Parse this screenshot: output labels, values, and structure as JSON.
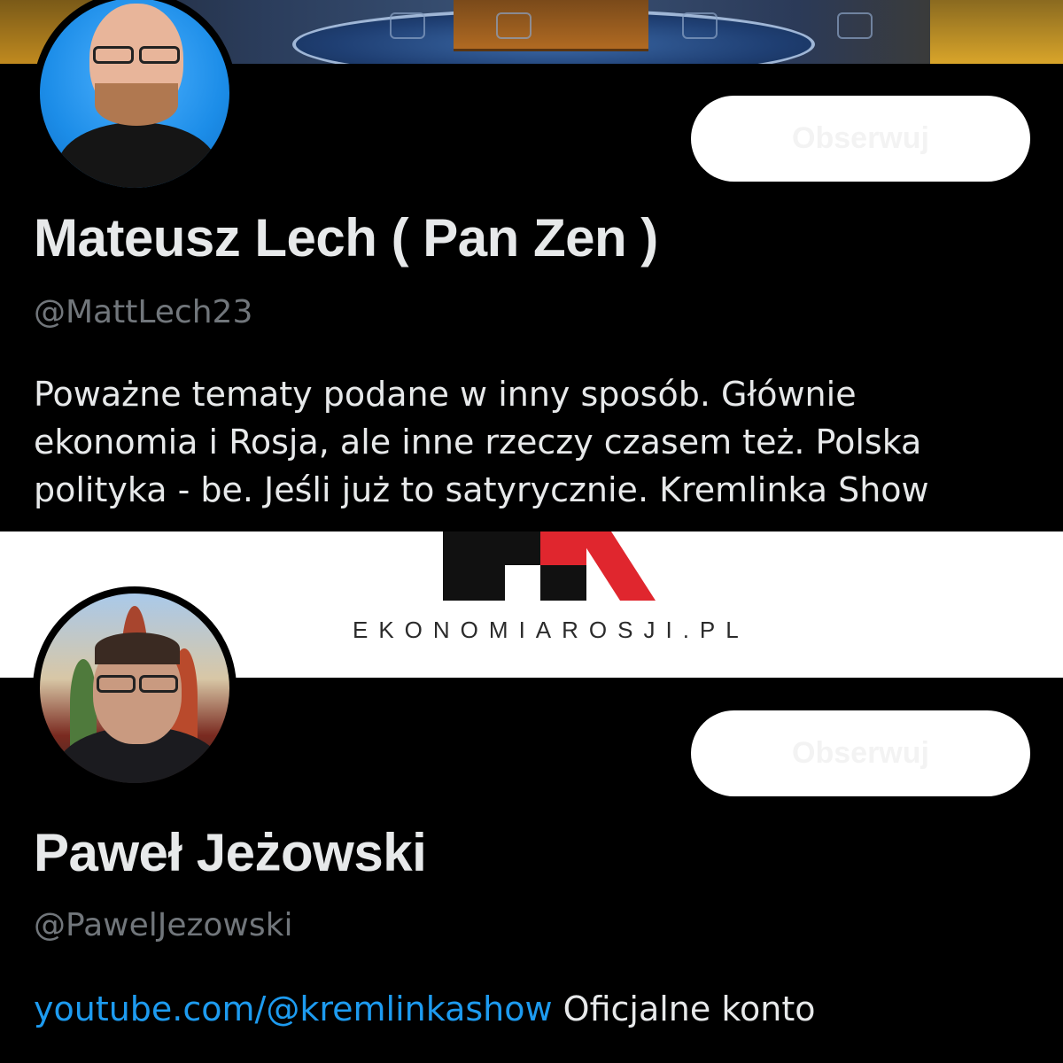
{
  "profiles": [
    {
      "display_name": "Mateusz Lech ( Pan Zen )",
      "handle": "@MattLech23",
      "bio_lines": [
        "Poważne tematy podane w inny sposób. Głównie",
        "ekonomia i Rosja, ale inne rzeczy czasem też. Polska",
        "polityka - be. Jeśli już to satyrycznie.  Kremlinka Show"
      ],
      "follow_label": "Obserwuj"
    },
    {
      "display_name": "Paweł Jeżowski",
      "handle": "@PawelJezowski",
      "bio_link": "youtube.com/@kremlinkashow",
      "bio_text": " Oficjalne konto",
      "follow_label": "Obserwuj"
    }
  ],
  "logo": {
    "text": "EKONOMIAROSJI.PL",
    "colors": {
      "dark": "#111111",
      "accent": "#e0262e"
    }
  },
  "colors": {
    "background": "#000000",
    "name": "#e7e9ea",
    "handle": "#71767b",
    "link": "#1d9bf0",
    "button": "#ffffff"
  }
}
